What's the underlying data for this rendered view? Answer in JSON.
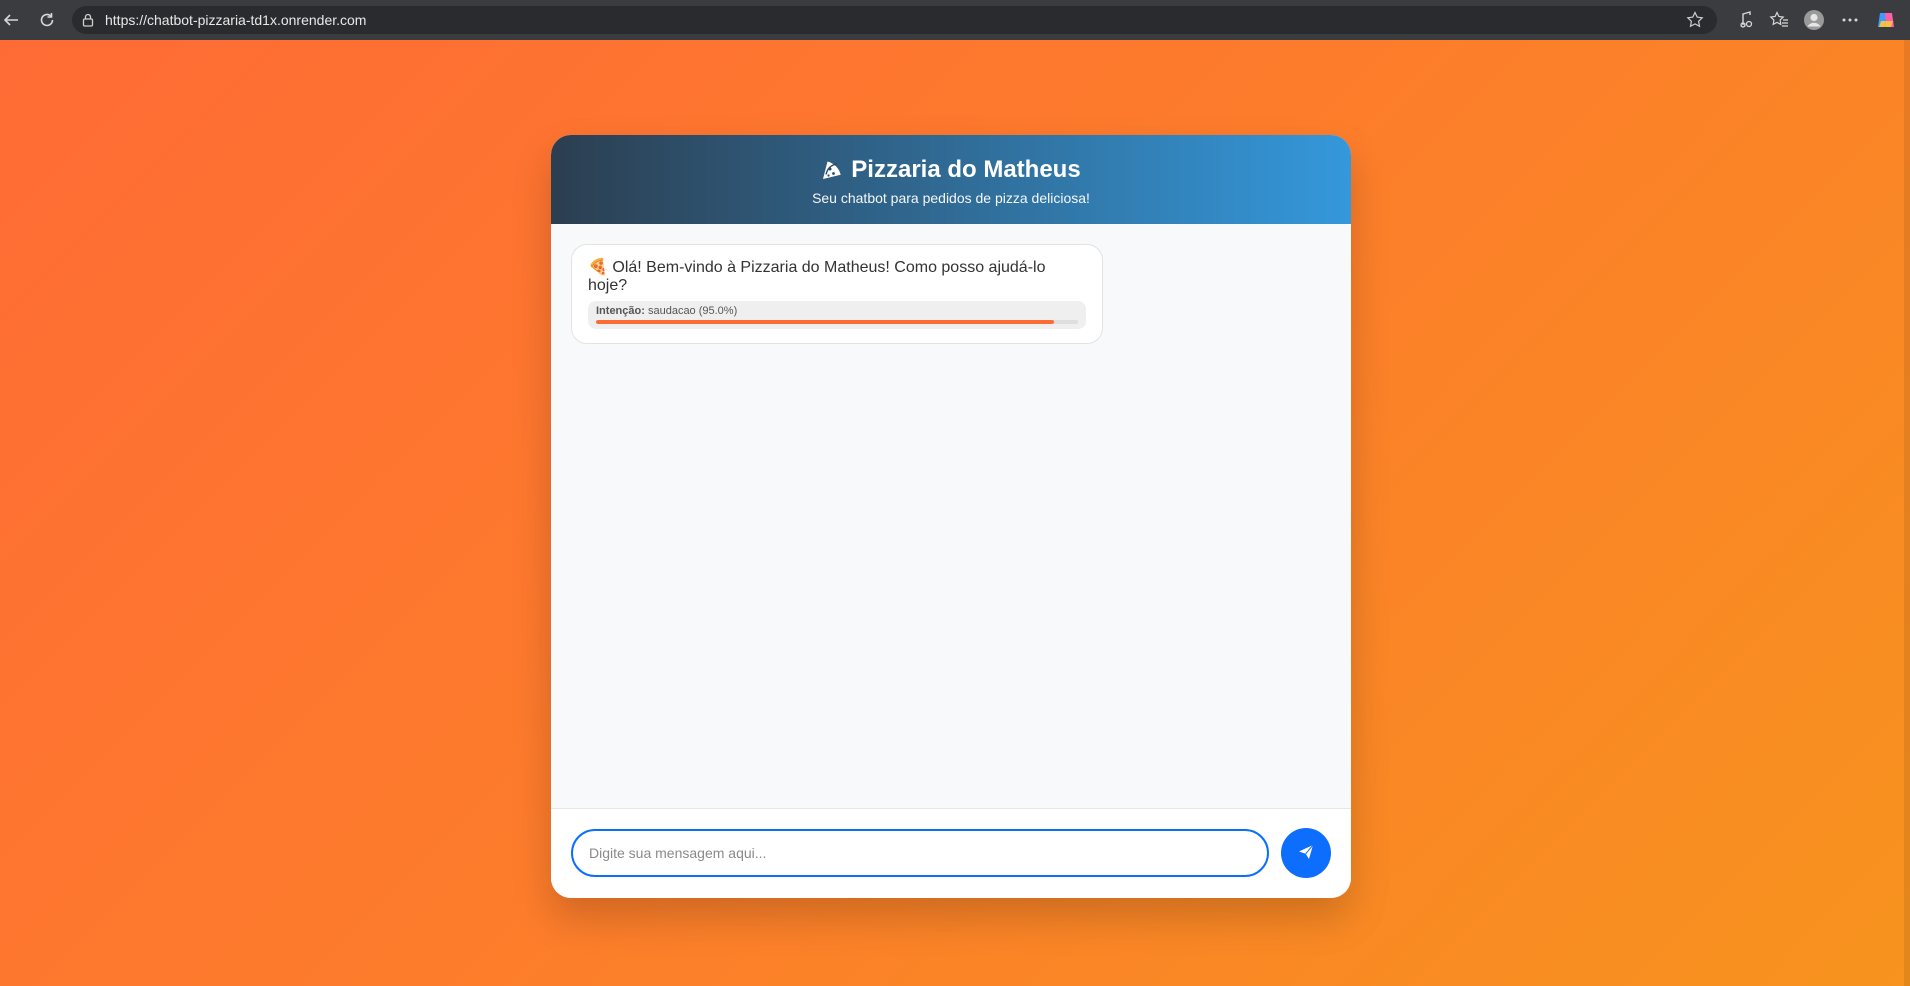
{
  "browser": {
    "url": "https://chatbot-pizzaria-td1x.onrender.com"
  },
  "header": {
    "title": "Pizzaria do Matheus",
    "subtitle": "Seu chatbot para pedidos de pizza deliciosa!"
  },
  "messages": [
    {
      "sender": "bot",
      "emoji": "🍕",
      "text": "Olá! Bem-vindo à Pizzaria do Matheus! Como posso ajudá-lo hoje?",
      "intent_label": "Intenção:",
      "intent_value": "saudacao (95.0%)",
      "confidence": 0.95
    }
  ],
  "input": {
    "placeholder": "Digite sua mensagem aqui..."
  },
  "colors": {
    "accent": "#0d6efd",
    "header_start": "#2c3e50",
    "header_end": "#3498db",
    "background_start": "#ff6b35",
    "background_end": "#f7931e",
    "confidence_bar": "#ff6b35"
  }
}
